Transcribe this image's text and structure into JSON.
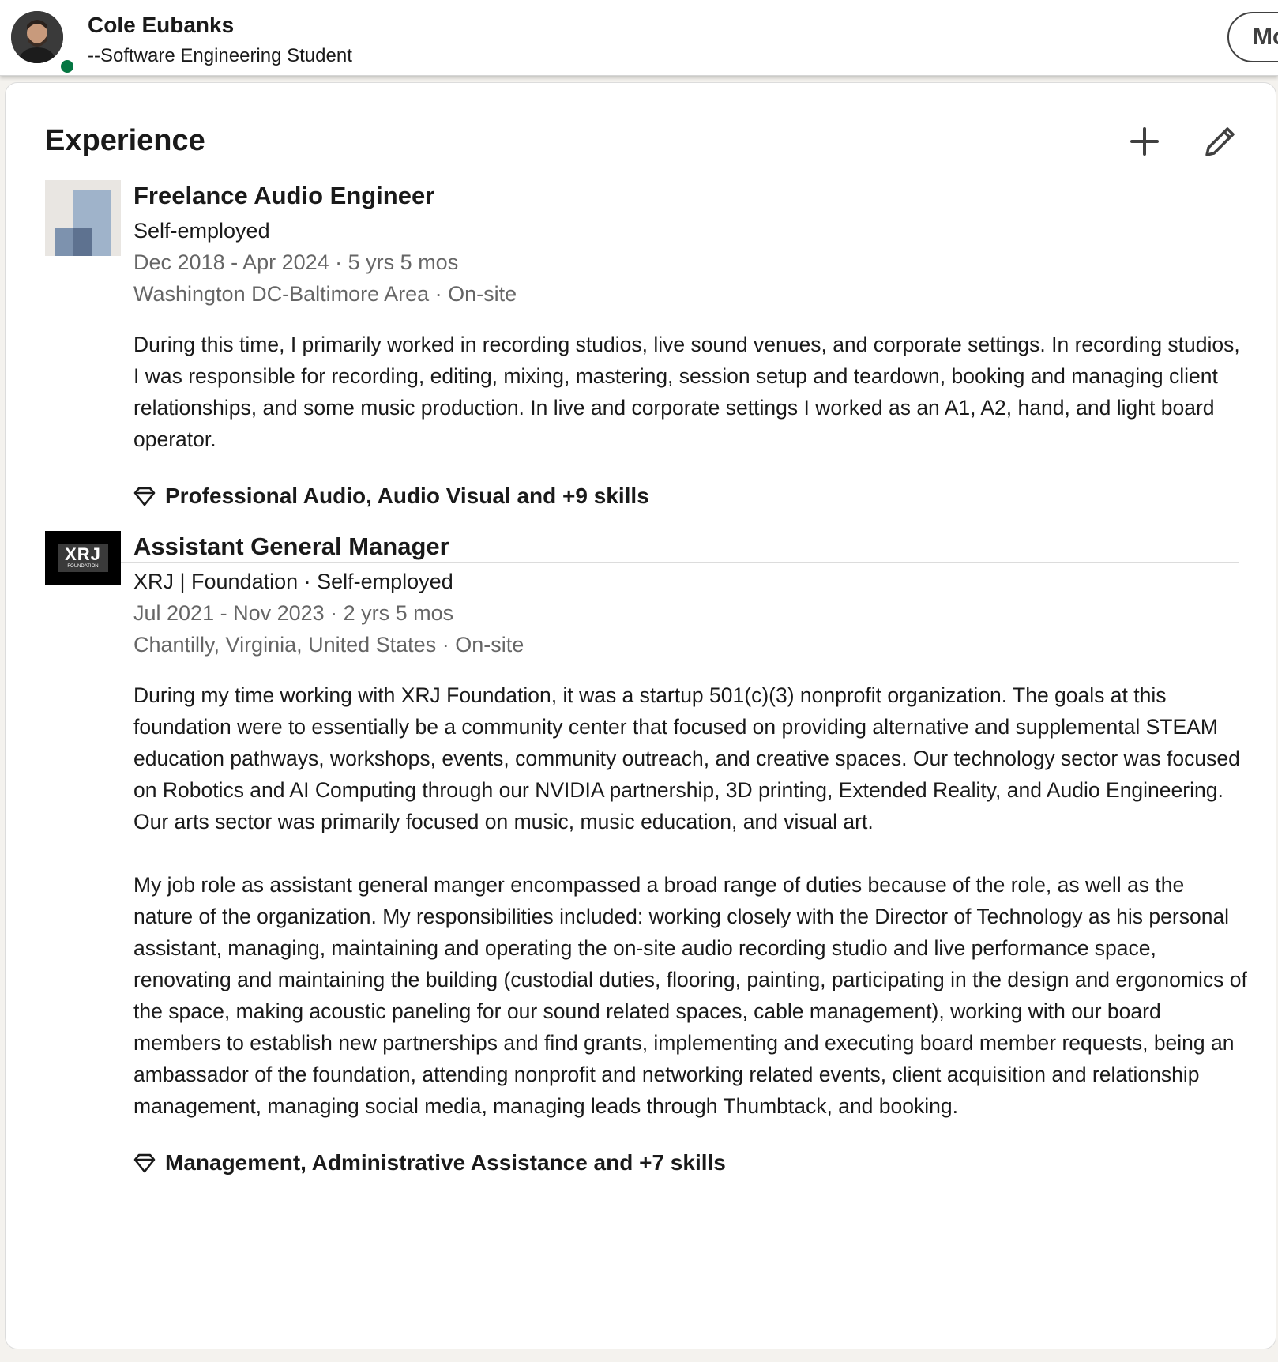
{
  "header": {
    "name": "Cole Eubanks",
    "headline": "--Software Engineering Student",
    "more_button_label": "Mo",
    "presence_color": "#057642"
  },
  "experience": {
    "title": "Experience",
    "add_icon": "plus-icon",
    "edit_icon": "pencil-icon",
    "entries": [
      {
        "logo": "abstract-squares-logo",
        "title": "Freelance Audio Engineer",
        "company": "Self-employed",
        "dates": "Dec 2018 - Apr 2024 · 5 yrs 5 mos",
        "location": "Washington DC-Baltimore Area · On-site",
        "description": "During this time, I primarily worked in recording studios, live sound venues, and corporate settings. In recording studios, I was responsible for recording, editing, mixing, mastering, session setup and teardown, booking and managing client relationships, and some music production. In live and corporate settings I worked as an A1, A2, hand, and light board operator.",
        "skills": "Professional Audio, Audio Visual and +9 skills"
      },
      {
        "logo": "xrj-foundation-logo",
        "logo_text": "XRJ",
        "logo_subtext": "FOUNDATION",
        "title": "Assistant General Manager",
        "company": "XRJ | Foundation · Self-employed",
        "dates": "Jul 2021 - Nov 2023 · 2 yrs 5 mos",
        "location": "Chantilly, Virginia, United States · On-site",
        "description": "During my time working with XRJ Foundation, it was a startup 501(c)(3) nonprofit organization. The goals at this foundation were to essentially be a community center that focused on providing alternative and supplemental STEAM education pathways, workshops, events, community outreach, and creative spaces. Our technology sector was focused on Robotics and AI Computing through our NVIDIA partnership, 3D printing, Extended Reality, and Audio Engineering. Our arts sector was primarily focused on music, music education, and visual art.\n\nMy job role as assistant general manger encompassed a broad range of duties because of the role, as well as the nature of the organization. My responsibilities included: working closely with the Director of Technology as his personal assistant, managing, maintaining and operating the on-site audio recording studio and live performance space, renovating and maintaining the building (custodial duties, flooring, painting, participating in the design and ergonomics of the space, making acoustic paneling for our sound related spaces, cable management), working with our board members to establish new partnerships and find grants, implementing and executing board member requests, being an ambassador of the foundation, attending nonprofit and networking related events, client acquisition and relationship management, managing social media, managing leads through Thumbtack, and booking.",
        "skills": "Management, Administrative Assistance and +7 skills"
      }
    ]
  }
}
